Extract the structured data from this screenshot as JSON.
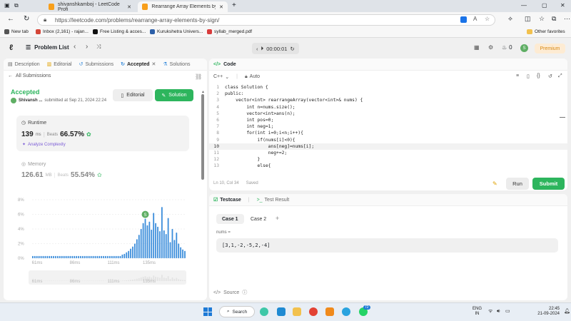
{
  "browser": {
    "tabs": [
      {
        "title": "shivanshkamboj - LeetCode Profi",
        "close": "✕"
      },
      {
        "title": "Rearrange Array Elements by Sign",
        "close": "✕"
      }
    ],
    "new_tab": "+",
    "window_controls": [
      "—",
      "▢",
      "✕"
    ],
    "url": "https://leetcode.com/problems/rearrange-array-elements-by-sign/",
    "bookmarks": [
      {
        "label": "New tab",
        "color": "#555555"
      },
      {
        "label": "Inbox (2,161) - rajan...",
        "color": "#d44638"
      },
      {
        "label": "Free Listing & acces...",
        "color": "#111111"
      },
      {
        "label": "Kurukshetra Univers...",
        "color": "#2c5fa8"
      },
      {
        "label": "syllab_merged.pdf",
        "color": "#d83b3b"
      }
    ],
    "other_favorites": "Other favorites"
  },
  "lc_header": {
    "problem_list": "Problem List",
    "timer": "00:00:01",
    "streak": "0",
    "avatar_letter": "S",
    "premium": "Premium"
  },
  "left_panel": {
    "tabs": [
      {
        "label": "Description",
        "icon": "description-icon"
      },
      {
        "label": "Editorial",
        "icon": "editorial-icon"
      },
      {
        "label": "Submissions",
        "icon": "history-icon"
      },
      {
        "label": "Accepted",
        "icon": "accepted-icon",
        "close": "✕"
      },
      {
        "label": "Solutions",
        "icon": "flask-icon"
      }
    ],
    "all_submissions": "All Submissions",
    "status": "Accepted",
    "user": "Shivansh ...",
    "submitted_at": "submitted at Sep 21, 2024 22:24",
    "editorial_btn": "Editorial",
    "solution_btn": "Solution",
    "runtime": {
      "title": "Runtime",
      "value": "139",
      "unit": "ms",
      "beats_label": "Beats",
      "beats": "66.57%",
      "analyze": "Analyze Complexity"
    },
    "memory": {
      "title": "Memory",
      "value": "126.61",
      "unit": "MB",
      "beats_label": "Beats",
      "beats": "55.54%"
    },
    "chart_marker": "S"
  },
  "chart_data": {
    "type": "bar",
    "ylim": [
      0,
      8
    ],
    "yticks": [
      "0%",
      "2%",
      "4%",
      "6%",
      "8%"
    ],
    "xticks": [
      "61ms",
      "86ms",
      "111ms",
      "135ms"
    ],
    "mini_xticks": [
      "61ms",
      "86ms",
      "111ms",
      "135ms"
    ],
    "values": [
      0.3,
      0.3,
      0.3,
      0.3,
      0.3,
      0.3,
      0.3,
      0.3,
      0.3,
      0.3,
      0.3,
      0.3,
      0.3,
      0.3,
      0.3,
      0.3,
      0.3,
      0.3,
      0.3,
      0.3,
      0.3,
      0.3,
      0.3,
      0.3,
      0.3,
      0.3,
      0.3,
      0.3,
      0.3,
      0.3,
      0.3,
      0.3,
      0.3,
      0.3,
      0.3,
      0.3,
      0.3,
      0.3,
      0.3,
      0.3,
      0.3,
      0.3,
      0.3,
      0.5,
      0.6,
      0.8,
      1.0,
      1.3,
      1.6,
      2.0,
      2.6,
      3.2,
      4.0,
      4.8,
      5.4,
      4.5,
      5.0,
      3.9,
      6.2,
      4.8,
      4.3,
      3.7,
      7.0,
      3.8,
      3.3,
      5.5,
      2.2,
      4.0,
      2.5,
      3.5,
      2.0,
      1.5,
      1.2,
      1.0
    ],
    "highlight_index": 54
  },
  "code_panel": {
    "title": "Code",
    "language": "C++",
    "mode": "Auto",
    "lines": [
      {
        "n": "1",
        "text": "class Solution {"
      },
      {
        "n": "2",
        "text": "public:"
      },
      {
        "n": "3",
        "text": "    vector<int> rearrangeArray(vector<int>& nums) {"
      },
      {
        "n": "4",
        "text": "        int n=nums.size();"
      },
      {
        "n": "5",
        "text": "        vector<int>ans(n);"
      },
      {
        "n": "6",
        "text": "        int pos=0;"
      },
      {
        "n": "7",
        "text": "        int neg=1;"
      },
      {
        "n": "8",
        "text": "        for(int i=0;i<n;i++){"
      },
      {
        "n": "9",
        "text": "            if(nums[i]<0){"
      },
      {
        "n": "10",
        "text": "                ans[neg]=nums[i];"
      },
      {
        "n": "11",
        "text": "                neg+=2;"
      },
      {
        "n": "12",
        "text": "            }"
      },
      {
        "n": "13",
        "text": "            else{"
      }
    ],
    "cursor_line": "10",
    "status_pos": "Ln 10, Col 34",
    "status_saved": "Saved",
    "run": "Run",
    "submit": "Submit"
  },
  "test_panel": {
    "tab_testcase": "Testcase",
    "tab_result": "Test Result",
    "cases": [
      "Case 1",
      "Case 2"
    ],
    "add": "+",
    "input_label": "nums =",
    "input_value": "[3,1,-2,-5,2,-4]",
    "source": "Source"
  },
  "taskbar": {
    "search": "Search",
    "lang1": "ENG",
    "lang2": "IN",
    "time": "22:45",
    "date": "21-09-2024",
    "badge": "72"
  },
  "colors": {
    "accent_green": "#2db55d",
    "bar_blue": "#3b8ddb"
  }
}
